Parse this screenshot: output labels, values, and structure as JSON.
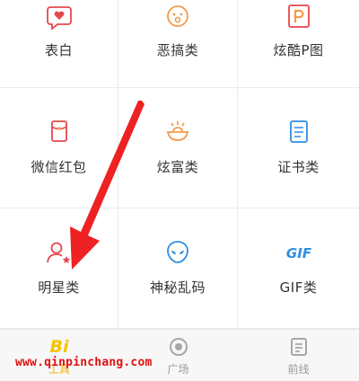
{
  "grid": {
    "items": [
      {
        "label": "表白",
        "icon": "heart-chat-icon"
      },
      {
        "label": "恶搞类",
        "icon": "funny-face-icon"
      },
      {
        "label": "炫酷P图",
        "icon": "p-photo-icon"
      },
      {
        "label": "微信红包",
        "icon": "red-envelope-icon"
      },
      {
        "label": "炫富类",
        "icon": "treasure-bowl-icon"
      },
      {
        "label": "证书类",
        "icon": "certificate-icon"
      },
      {
        "label": "明星类",
        "icon": "star-person-icon"
      },
      {
        "label": "神秘乱码",
        "icon": "alien-icon"
      },
      {
        "label": "GIF类",
        "icon": "gif-icon",
        "icon_text": "GIF"
      }
    ]
  },
  "tabbar": {
    "tabs": [
      {
        "label": "工具",
        "icon_text": "Bi",
        "active": true
      },
      {
        "label": "广场",
        "icon": "square-icon"
      },
      {
        "label": "前线",
        "icon": "news-icon"
      }
    ]
  },
  "watermark": "www.qinpinchang.com",
  "colors": {
    "accent_red": "#e5484d",
    "accent_orange": "#f39a4a",
    "accent_blue": "#2f8de4",
    "tab_active": "#f5b400",
    "arrow_red": "#ee2222"
  }
}
